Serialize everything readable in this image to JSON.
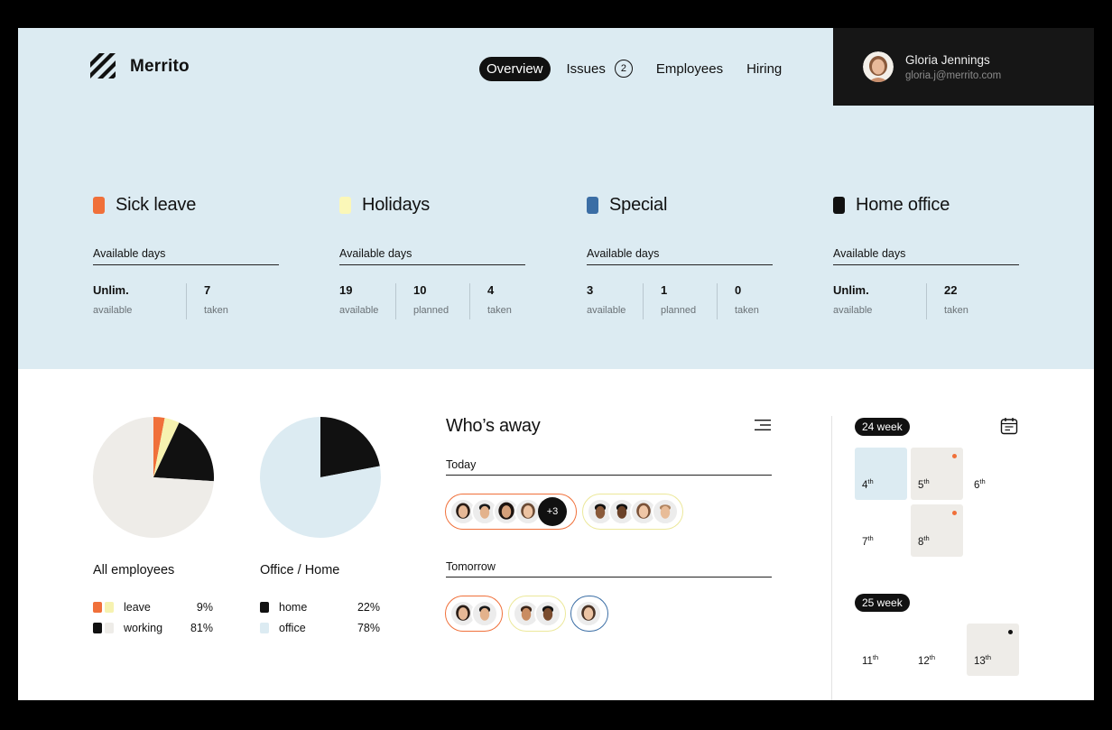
{
  "brand": {
    "name": "Merrito"
  },
  "nav": [
    {
      "label": "Overview",
      "active": true
    },
    {
      "label": "Issues",
      "badge": "2"
    },
    {
      "label": "Employees"
    },
    {
      "label": "Hiring"
    }
  ],
  "user": {
    "name": "Gloria Jennings",
    "email": "gloria.j@merrito.com"
  },
  "leave_cards": [
    {
      "title": "Sick leave",
      "color": "#f0703a",
      "available_label": "Available days",
      "stats": [
        {
          "value": "Unlim.",
          "label": "available"
        },
        {
          "value": "7",
          "label": "taken"
        }
      ]
    },
    {
      "title": "Holidays",
      "color": "#fbf7b8",
      "available_label": "Available days",
      "stats": [
        {
          "value": "19",
          "label": "available"
        },
        {
          "value": "10",
          "label": "planned"
        },
        {
          "value": "4",
          "label": "taken"
        }
      ]
    },
    {
      "title": "Special",
      "color": "#3b6ea5",
      "available_label": "Available days",
      "stats": [
        {
          "value": "3",
          "label": "available"
        },
        {
          "value": "1",
          "label": "planned"
        },
        {
          "value": "0",
          "label": "taken"
        }
      ]
    },
    {
      "title": "Home office",
      "color": "#111111",
      "available_label": "Available days",
      "stats": [
        {
          "value": "Unlim.",
          "label": "available"
        },
        {
          "value": "22",
          "label": "taken"
        }
      ]
    }
  ],
  "pies": {
    "all_employees": {
      "title": "All employees",
      "legend": [
        {
          "label": "leave",
          "value": "9%"
        },
        {
          "label": "working",
          "value": "81%"
        }
      ]
    },
    "office_home": {
      "title": "Office / Home",
      "legend": [
        {
          "label": "home",
          "value": "22%"
        },
        {
          "label": "office",
          "value": "78%"
        }
      ]
    }
  },
  "chart_data": [
    {
      "type": "pie",
      "title": "All employees",
      "slices": [
        {
          "label": "sick leave",
          "value": 3,
          "color": "#f0703a"
        },
        {
          "label": "holidays",
          "value": 4,
          "color": "#f6f2b0"
        },
        {
          "label": "home office",
          "value": 19,
          "color": "#111111"
        },
        {
          "label": "working",
          "value": 74,
          "color": "#eeece8"
        }
      ]
    },
    {
      "type": "pie",
      "title": "Office / Home",
      "slices": [
        {
          "label": "home",
          "value": 22,
          "color": "#111111"
        },
        {
          "label": "office",
          "value": 78,
          "color": "#dcebf2"
        }
      ]
    }
  ],
  "whos_away": {
    "title": "Who’s away",
    "today_label": "Today",
    "tomorrow_label": "Tomorrow",
    "today_more": "+3"
  },
  "calendar": {
    "weeks": [
      {
        "label": "24 week",
        "days": [
          {
            "num": "4",
            "suffix": "th",
            "style": "blue"
          },
          {
            "num": "5",
            "suffix": "th",
            "style": "grey",
            "dot": "#f0703a"
          },
          {
            "num": "6",
            "suffix": "th",
            "style": "none"
          },
          {
            "num": "7",
            "suffix": "th",
            "style": "none"
          },
          {
            "num": "8",
            "suffix": "th",
            "style": "grey",
            "dot": "#f0703a"
          }
        ]
      },
      {
        "label": "25 week",
        "days": [
          {
            "num": "11",
            "suffix": "th",
            "style": "none"
          },
          {
            "num": "12",
            "suffix": "th",
            "style": "none"
          },
          {
            "num": "13",
            "suffix": "th",
            "style": "grey",
            "dot": "#111111"
          }
        ]
      }
    ]
  }
}
